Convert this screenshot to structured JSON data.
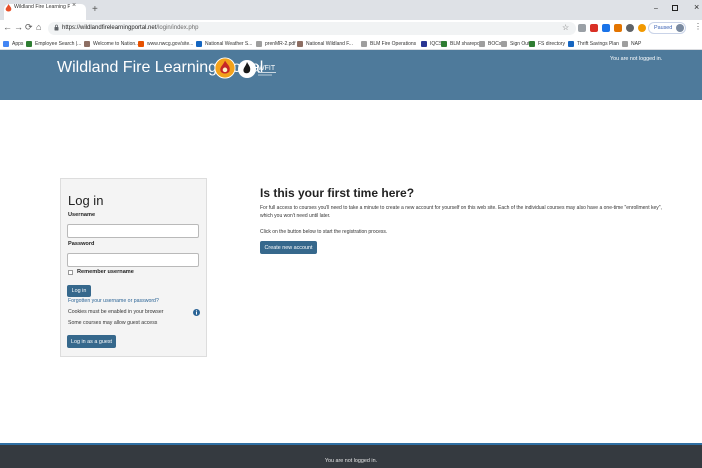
{
  "browser": {
    "tab_title": "Wildland Fire Learning Portal: Lo",
    "tab_close": "×",
    "new_tab": "+",
    "window_controls": {
      "minimize": "–",
      "close": "×"
    },
    "nav": {
      "back": "←",
      "forward": "→",
      "reload": "⟳",
      "home": "⌂"
    },
    "url_protocol": "https://",
    "url_host": "wildlandfirelearningportal.net",
    "url_path": "/login/index.php",
    "star": "☆",
    "profile_status": "Paused",
    "menu": "⋮",
    "bookmarks": [
      {
        "label": "Apps",
        "color": "#4285f4"
      },
      {
        "label": "Employee Search |...",
        "color": "#2e7d32"
      },
      {
        "label": "Welcome to Nation...",
        "color": "#8d6e63"
      },
      {
        "label": "www.nwcg.gov/site...",
        "color": "#e65100"
      },
      {
        "label": "National Weather S...",
        "color": "#1565c0"
      },
      {
        "label": "prenMR-2.pdf",
        "color": "#9e9e9e"
      },
      {
        "label": "National Wildland F...",
        "color": "#8d6e63"
      },
      {
        "label": "BLM Fire Operations",
        "color": "#9e9e9e"
      },
      {
        "label": "IQCS",
        "color": "#283593"
      },
      {
        "label": "BLM sharepoint",
        "color": "#2e7d32"
      },
      {
        "label": "BOCs",
        "color": "#9e9e9e"
      },
      {
        "label": "Sign Out",
        "color": "#9e9e9e"
      },
      {
        "label": "FS directory",
        "color": "#2e7d32"
      },
      {
        "label": "Thrift Savings Plan",
        "color": "#1565c0"
      },
      {
        "label": "NAP",
        "color": "#9e9e9e"
      }
    ]
  },
  "header": {
    "site_title": "Wildland Fire Learning Portal",
    "logo2_text": "WFIT",
    "login_status": "You are not logged in.",
    "bg_color": "#4e7a9b"
  },
  "login": {
    "title": "Log in",
    "username_label": "Username",
    "username_value": "",
    "password_label": "Password",
    "password_value": "",
    "remember_label": "Remember username",
    "login_button": "Log in",
    "forgot_link": "Forgotten your username or password?",
    "cookies_text": "Cookies must be enabled in your browser",
    "guest_text": "Some courses may allow guest access",
    "guest_button": "Log in as a guest"
  },
  "signup": {
    "title": "Is this your first time here?",
    "paragraph1": "For full access to courses you'll need to take a minute to create a new account for yourself on this web site. Each of the individual courses may also have a one-time \"enrollment key\", which you won't need until later.",
    "paragraph2": "Click on the button below to start the registration process.",
    "create_button": "Create new account"
  },
  "footer": {
    "login_status": "You are not logged in."
  },
  "colors": {
    "primary_button": "#36688c",
    "link": "#2b6496",
    "footer_bg": "#353a40"
  }
}
